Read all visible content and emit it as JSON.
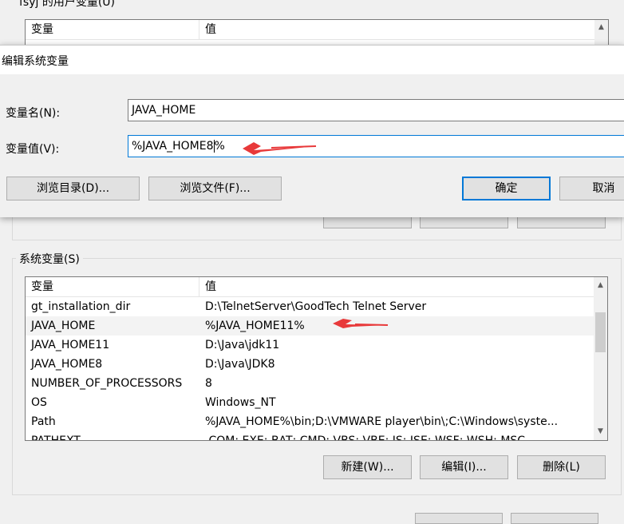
{
  "user_vars": {
    "title": "fsyj 的用户变量(U)",
    "col_variable": "变量",
    "col_value": "值"
  },
  "dialog": {
    "title": "编辑系统变量",
    "name_label": "变量名(N):",
    "name_value": "JAVA_HOME",
    "value_label": "变量值(V):",
    "value_before_caret": "%JAVA_HOME8",
    "value_after_caret": "%",
    "browse_dir_label": "浏览目录(D)...",
    "browse_file_label": "浏览文件(F)...",
    "ok_label": "确定",
    "cancel_label": "取消"
  },
  "system_vars": {
    "title": "系统变量(S)",
    "col_variable": "变量",
    "col_value": "值",
    "rows": [
      {
        "name": "gt_installation_dir",
        "value": "D:\\TelnetServer\\GoodTech Telnet Server"
      },
      {
        "name": "JAVA_HOME",
        "value": "%JAVA_HOME11%"
      },
      {
        "name": "JAVA_HOME11",
        "value": "D:\\Java\\jdk11"
      },
      {
        "name": "JAVA_HOME8",
        "value": "D:\\Java\\JDK8"
      },
      {
        "name": "NUMBER_OF_PROCESSORS",
        "value": "8"
      },
      {
        "name": "OS",
        "value": "Windows_NT"
      },
      {
        "name": "Path",
        "value": "%JAVA_HOME%\\bin;D:\\VMWARE player\\bin\\;C:\\Windows\\syste..."
      },
      {
        "name": "PATHEXT",
        "value": ".COM;.EXE;.BAT;.CMD;.VBS;.VBE;.JS;.JSE;.WSF;.WSH;.MSC"
      }
    ],
    "new_label": "新建(W)...",
    "edit_label": "编辑(I)...",
    "delete_label": "删除(L)"
  },
  "annotation_color": "#e8393a",
  "icons": {
    "scroll_up": "▲",
    "scroll_down": "▼"
  }
}
